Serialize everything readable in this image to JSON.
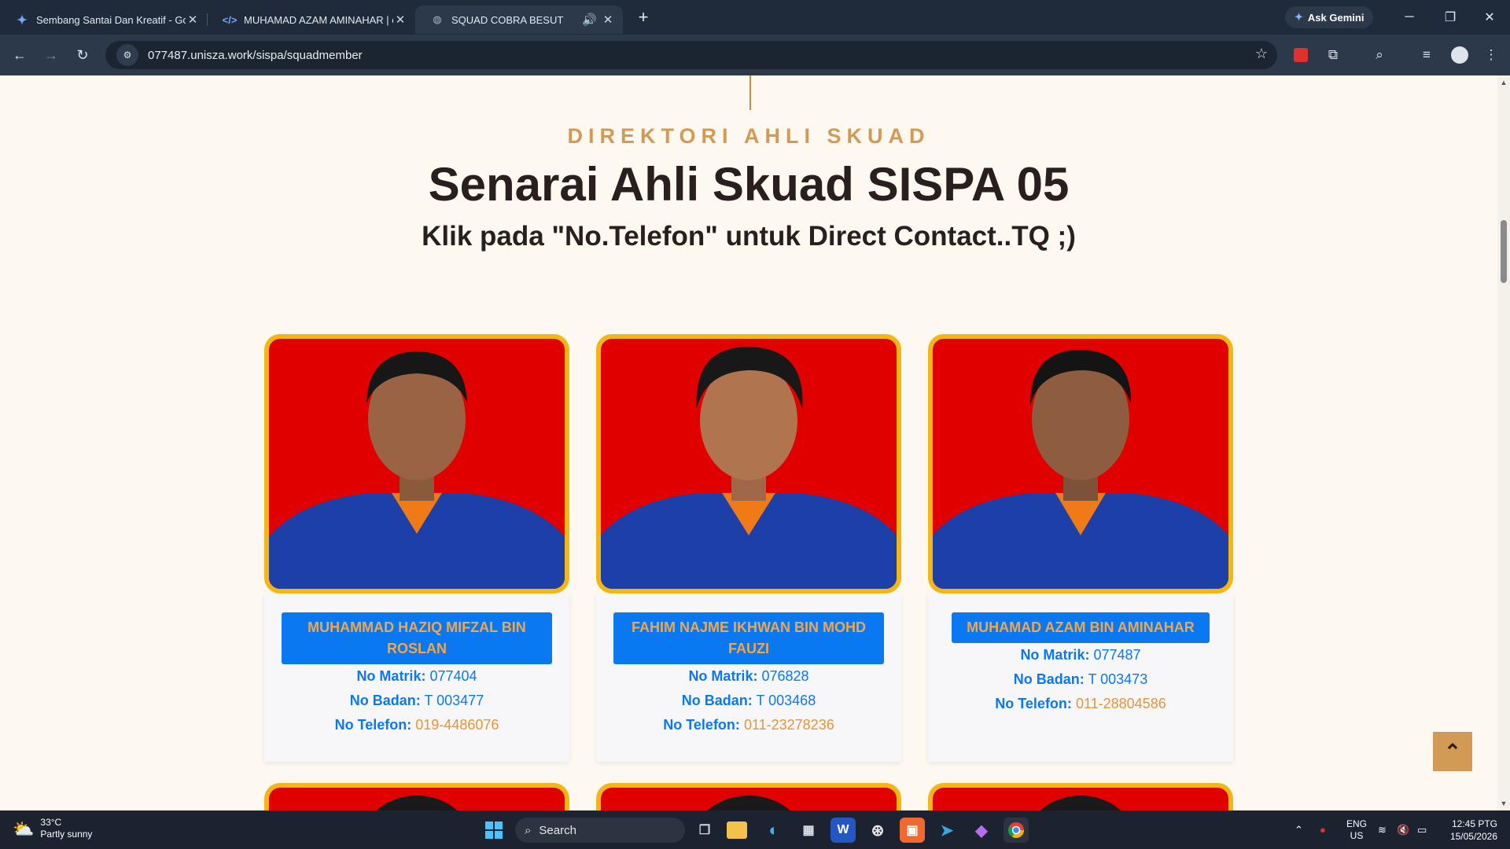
{
  "browser": {
    "tabs": [
      {
        "title": "Sembang Santai Dan Kreatif - Goo",
        "icon": "gemini-icon",
        "active": false
      },
      {
        "title": "MUHAMAD AZAM AMINAHAR | e",
        "icon": "code-icon",
        "active": false
      },
      {
        "title": "SQUAD COBRA BESUT",
        "icon": "globe-icon",
        "active": true
      }
    ],
    "ask_gemini": "Ask Gemini",
    "url": "077487.unisza.work/sispa/squadmember"
  },
  "page": {
    "eyebrow": "DIREKTORI AHLI SKUAD",
    "headline": "Senarai Ahli Skuad SISPA 05",
    "subheading": "Klik pada \"No.Telefon\" untuk Direct Contact..TQ ;)",
    "labels": {
      "matrik": "No Matrik:",
      "badan": "No Badan:",
      "telefon": "No Telefon:"
    },
    "members": [
      {
        "name": "MUHAMMAD HAZIQ MIFZAL BIN ROSLAN",
        "matrik": "077404",
        "badan": "T 003477",
        "telefon": "019-4486076"
      },
      {
        "name": "FAHIM NAJME IKHWAN BIN MOHD FAUZI",
        "matrik": "076828",
        "badan": "T 003468",
        "telefon": "011-23278236"
      },
      {
        "name": "MUHAMAD AZAM BIN AMINAHAR",
        "matrik": "077487",
        "badan": "T 003473",
        "telefon": "011-28804586"
      }
    ],
    "back_to_top_icon": "chevron-double-up-icon"
  },
  "taskbar": {
    "weather_temp": "33°C",
    "weather_desc": "Partly sunny",
    "search_placeholder": "Search",
    "lang_top": "ENG",
    "lang_bottom": "US",
    "time": "12:45 PTG",
    "date": "15/05/2026"
  },
  "colors": {
    "accent": "#d39a55",
    "name_badge": "#0a78f0",
    "photo_bg": "#e00000",
    "photo_border": "#f3b715"
  }
}
